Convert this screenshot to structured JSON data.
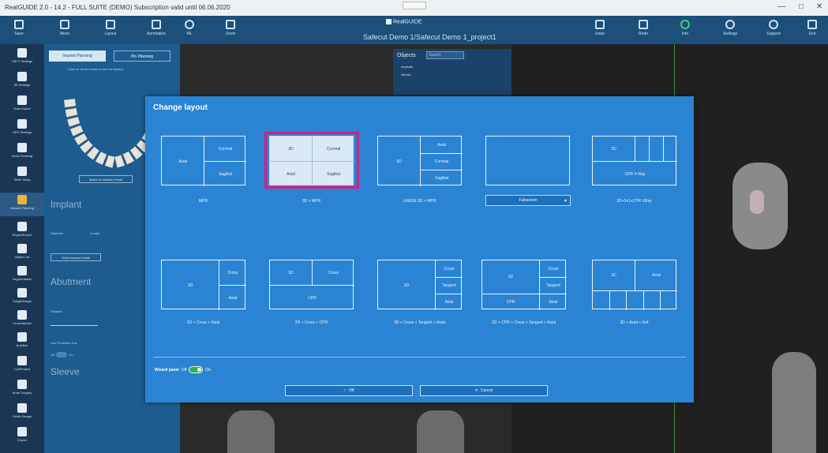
{
  "window": {
    "title": "RealGUIDE 2.0 - 14.2 - FULL SUITE (DEMO) Subscription valid until 06.06.2020",
    "controls": {
      "minimize": "—",
      "maximize": "□",
      "close": "✕"
    }
  },
  "brand": "RealGUIDE",
  "project_title": "Safecut Demo 1/Safecut Demo 1_project1",
  "toolbar": {
    "left": [
      {
        "label": "Save",
        "icon": "save-icon"
      },
      {
        "label": "Move",
        "icon": "move-icon"
      },
      {
        "label": "Layout",
        "icon": "layout-icon"
      },
      {
        "label": "Annotation",
        "icon": "annotation-icon"
      },
      {
        "label": "WL",
        "icon": "window-level-icon"
      },
      {
        "label": "Zoom",
        "icon": "zoom-icon"
      }
    ],
    "right": [
      {
        "label": "Undo",
        "icon": "undo-icon"
      },
      {
        "label": "Redo",
        "icon": "redo-icon"
      },
      {
        "label": "Info",
        "icon": "info-icon"
      },
      {
        "label": "Settings",
        "icon": "gear-icon"
      },
      {
        "label": "Support",
        "icon": "support-icon"
      },
      {
        "label": "Exit",
        "icon": "exit-icon"
      }
    ]
  },
  "sidebar": {
    "items": [
      {
        "label": "CBCT Settings"
      },
      {
        "label": "3D Settings"
      },
      {
        "label": "Scan Import"
      },
      {
        "label": "OPG Settings"
      },
      {
        "label": "Nerve Drawing"
      },
      {
        "label": "Teeth Setup"
      },
      {
        "label": "Implant Planning"
      },
      {
        "label": "Report/Export"
      },
      {
        "label": "Object List"
      },
      {
        "label": "Segmentation"
      },
      {
        "label": "SurgicDesign"
      },
      {
        "label": "Crown/Model"
      },
      {
        "label": "AutoBar"
      },
      {
        "label": "Cut/Project"
      },
      {
        "label": "Bone Surgery"
      },
      {
        "label": "Guide Design"
      },
      {
        "label": "Export"
      }
    ]
  },
  "panel": {
    "tab_implant": "Implant Planning",
    "tab_pin": "Pin Planning",
    "hint": "Click on Teeth names to add an implant",
    "teeth_button": "Switch to Maxilla Preset",
    "implant_heading": "Implant",
    "diameter_label": "Diameter",
    "length_label": "Length",
    "show_button": "Show implant heads",
    "abutment_heading": "Abutment",
    "rotation_label": "Rotation",
    "use_predef_label": "Use Predefine Axis",
    "sleeve_heading": "Sleeve",
    "toggle_off": "Off",
    "toggle_on": "On"
  },
  "objects_panel": {
    "title": "Objects",
    "search_placeholder": "Search",
    "row1": "Implants",
    "row2": "Nerves"
  },
  "dialog": {
    "title": "Change layout",
    "wizard_label": "Wizard panel",
    "wizard_off": "Off",
    "wizard_on": "On",
    "ok_label": "OK",
    "cancel_label": "Cancel",
    "fullscreen_label": "Fullscreen",
    "layouts": [
      {
        "caption": "MPR",
        "cells": [
          "Axial",
          "Coronal",
          "Sagittal"
        ]
      },
      {
        "caption": "3D + MPR",
        "cells": [
          "3D",
          "Coronal",
          "Axial",
          "Sagittal"
        ],
        "selected": true
      },
      {
        "caption": "LARGE 3D + MPR",
        "cells": [
          "3D",
          "Axial",
          "Coronal",
          "Sagittal"
        ]
      },
      {
        "caption": "",
        "cells": []
      },
      {
        "caption": "3D+3x1+CPR XRay",
        "cells": [
          "3D",
          "CPR X-Ray"
        ]
      },
      {
        "caption": "3D + Cross + Axial",
        "cells": [
          "3D",
          "Cross",
          "Axial"
        ]
      },
      {
        "caption": "3D + Cross + CPR",
        "cells": [
          "3D",
          "Cross",
          "CPR"
        ]
      },
      {
        "caption": "3D + Cross + Tangent + Axial",
        "cells": [
          "3D",
          "Cross",
          "Tangent",
          "Axial"
        ]
      },
      {
        "caption": "3D + CPR + Cross + Tangent + Axial",
        "cells": [
          "3D",
          "Cross",
          "Tangent",
          "CPR",
          "Axial"
        ]
      },
      {
        "caption": "3D + Axial + 5x4",
        "cells": [
          "3D",
          "Axial"
        ]
      }
    ]
  }
}
